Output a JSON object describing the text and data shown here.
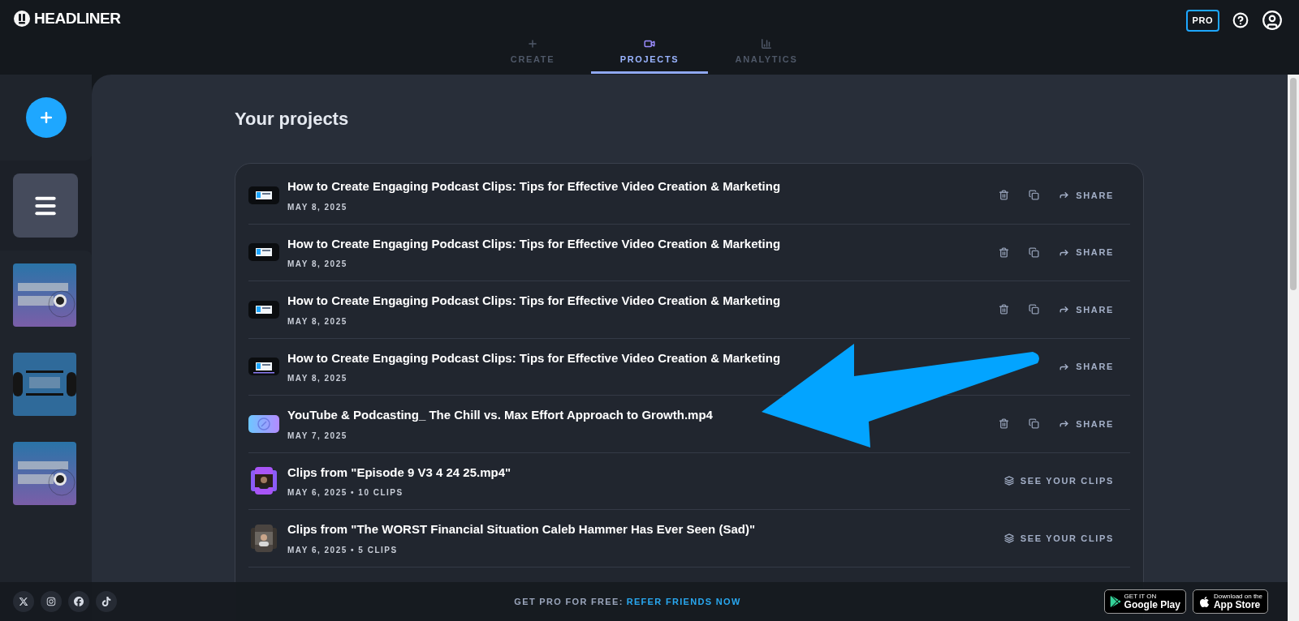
{
  "brand": "HEADLINER",
  "header": {
    "badge": "PRO"
  },
  "tabs": [
    {
      "label": "CREATE",
      "selected": false
    },
    {
      "label": "PROJECTS",
      "selected": true
    },
    {
      "label": "ANALYTICS",
      "selected": false
    }
  ],
  "title": "Your projects",
  "projects": [
    {
      "kind": "video",
      "title": "How to Create Engaging Podcast Clips: Tips for Effective Video Creation & Marketing",
      "meta": "MAY 8, 2025",
      "tools_visible": true,
      "action_label": "SHARE"
    },
    {
      "kind": "video",
      "title": "How to Create Engaging Podcast Clips: Tips for Effective Video Creation & Marketing",
      "meta": "MAY 8, 2025",
      "tools_visible": true,
      "action_label": "SHARE"
    },
    {
      "kind": "video",
      "title": "How to Create Engaging Podcast Clips: Tips for Effective Video Creation & Marketing",
      "meta": "MAY 8, 2025",
      "tools_visible": true,
      "action_label": "SHARE"
    },
    {
      "kind": "video",
      "title": "How to Create Engaging Podcast Clips: Tips for Effective Video Creation & Marketing",
      "meta": "MAY 8, 2025",
      "tools_visible": false,
      "action_label": "SHARE"
    },
    {
      "kind": "file",
      "title": "YouTube & Podcasting_ The Chill vs. Max Effort Approach to Growth.mp4",
      "meta": "MAY 7, 2025",
      "tools_visible": true,
      "action_label": "SHARE"
    },
    {
      "kind": "clips",
      "title": "Clips from \"Episode 9 V3 4 24 25.mp4\"",
      "meta": "MAY 6, 2025 • 10 CLIPS",
      "action_label": "SEE YOUR CLIPS"
    },
    {
      "kind": "clips",
      "title": "Clips from \"The WORST Financial Situation Caleb Hammer Has Ever Seen (Sad)\"",
      "meta": "MAY 6, 2025 • 5 CLIPS",
      "action_label": "SEE YOUR CLIPS"
    }
  ],
  "footer": {
    "promo": "GET PRO FOR FREE:",
    "link": "REFER FRIENDS NOW",
    "stores": [
      {
        "kind": "google",
        "small": "GET IT ON",
        "big": "Google Play"
      },
      {
        "kind": "apple",
        "small": "Download on the",
        "big": "App Store"
      }
    ]
  },
  "annotation": {
    "kind": "arrow"
  }
}
